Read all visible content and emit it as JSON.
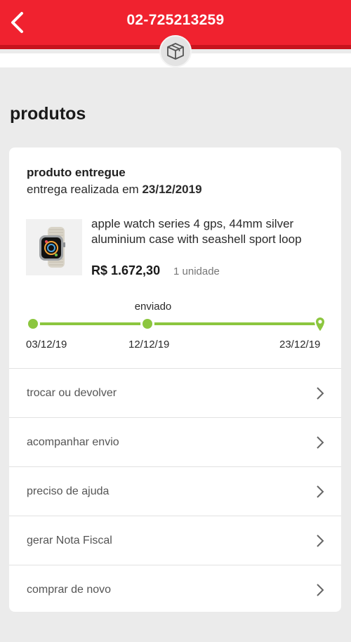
{
  "header": {
    "title": "02-725213259",
    "accent_color": "#f0222f",
    "back_icon": "chevron-left-icon",
    "badge_icon": "package-box-icon"
  },
  "section": {
    "title": "produtos"
  },
  "order": {
    "status_title": "produto entregue",
    "status_prefix": "entrega realizada em",
    "delivery_date": "23/12/2019",
    "product": {
      "image_icon": "apple-watch-image",
      "name": "apple watch series 4 gps, 44mm silver aluminium case with seashell sport loop",
      "price": "R$ 1.672,30",
      "quantity": "1 unidade"
    },
    "timeline": {
      "progress_color": "#8cc63f",
      "current_label": "enviado",
      "steps": [
        {
          "date": "03/12/19"
        },
        {
          "date": "12/12/19"
        },
        {
          "date": "23/12/19"
        }
      ],
      "progress": 1.0
    }
  },
  "menu": {
    "chevron_icon": "chevron-right-icon",
    "items": [
      {
        "label": "trocar ou devolver"
      },
      {
        "label": "acompanhar envio"
      },
      {
        "label": "preciso de ajuda"
      },
      {
        "label": "gerar Nota Fiscal"
      },
      {
        "label": "comprar de novo"
      }
    ]
  }
}
